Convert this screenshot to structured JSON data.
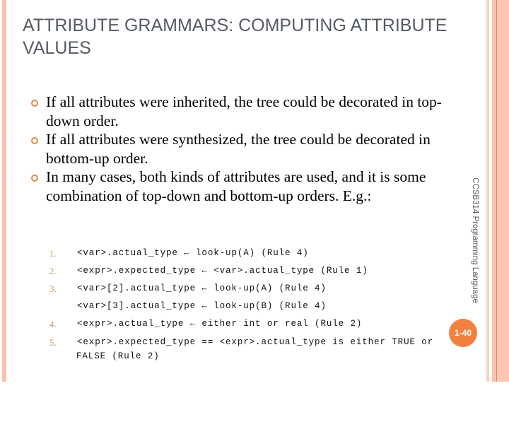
{
  "slide": {
    "title": "ATTRIBUTE GRAMMARS: COMPUTING ATTRIBUTE VALUES",
    "bullets": [
      "If all attributes were inherited, the tree could be decorated in top-down order.",
      "If all attributes were synthesized, the tree could be decorated in bottom-up order.",
      "In many cases, both kinds of attributes are used, and it is some combination of top-down and bottom-up orders. E.g.:"
    ],
    "code_items": [
      {
        "number": "1.",
        "text": "<var>.actual_type ← look-up(A) (Rule 4)"
      },
      {
        "number": "2.",
        "text": "<expr>.expected_type ← <var>.actual_type (Rule 1)"
      },
      {
        "number": "3.",
        "text": "<var>[2].actual_type ← look-up(A) (Rule 4)"
      },
      {
        "number": "",
        "text": "<var>[3].actual_type ← look-up(B) (Rule 4)"
      },
      {
        "number": "4.",
        "text": "<expr>.actual_type ← either int or real (Rule 2)"
      },
      {
        "number": "5.",
        "text": "<expr>.expected_type == <expr>.actual_type is either TRUE or",
        "continuation": "FALSE (Rule 2)"
      }
    ],
    "course_label": "CCSB314 Programming Language",
    "page_number": "1-40",
    "colors": {
      "accent": "#f28140",
      "bullet": "#e0894a",
      "stripe": "#f9c3ad",
      "title_text": "#555b63"
    }
  }
}
